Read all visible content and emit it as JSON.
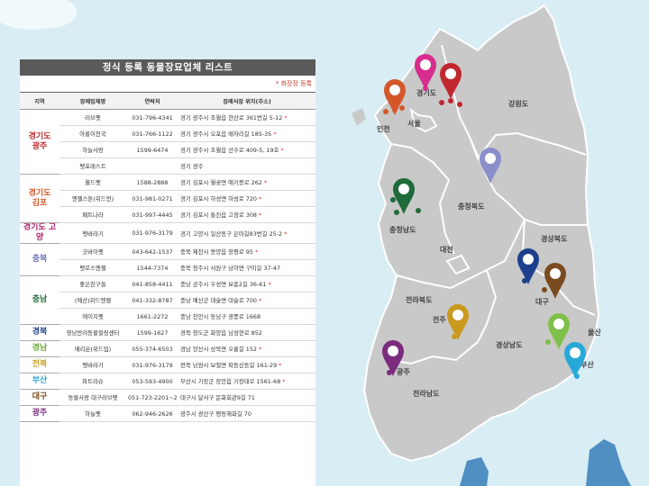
{
  "title": "정식 등록 동물장묘업체 리스트",
  "note": "* 화장장 등록",
  "headers": [
    "지역",
    "장례업체명",
    "연락처",
    "장례식장 위치(주소)"
  ],
  "groups": [
    {
      "region": "경기도\n광주",
      "color": "#c0282e",
      "rows": [
        {
          "name": "러브펫",
          "phone": "031-796-4341",
          "address": "경기 광주시 초월읍 현산로 361번길 5-12",
          "crem": true
        },
        {
          "name": "아롱이천국",
          "phone": "031-766-1122",
          "address": "경기 광주시 오포읍 매자리길 185-35",
          "crem": true
        },
        {
          "name": "하늘사랑",
          "phone": "1599-6474",
          "address": "경기 광주시 초월읍 산수로 409-5, 19호",
          "crem": true
        },
        {
          "name": "펫포레스트",
          "phone": "",
          "address": "경기 광주",
          "crem": false
        }
      ]
    },
    {
      "region": "경기도\n김포",
      "color": "#d4572a",
      "rows": [
        {
          "name": "월드펫",
          "phone": "1588-2888",
          "address": "경기 김포시 월곶면 애기봉로 262",
          "crem": true
        },
        {
          "name": "엔젤스톤(위드언)",
          "phone": "031-981-0271",
          "address": "경기 김포시 하성면 하성로 720",
          "crem": true
        },
        {
          "name": "페트나라",
          "phone": "031-997-4445",
          "address": "경기 김포시 통진읍 고정로 308",
          "crem": true
        }
      ]
    },
    {
      "region": "경기도 고양",
      "color": "#b5226e",
      "rows": [
        {
          "name": "펫바라기",
          "phone": "031-976-3179",
          "address": "경기 고양시 일산동구 은마길83번길 25-2",
          "crem": true
        }
      ]
    },
    {
      "region": "충북",
      "color": "#6a6fb5",
      "rows": [
        {
          "name": "굿바이펫",
          "phone": "043-642-1537",
          "address": "충북 제천시 봉양읍 장평로 95",
          "crem": true
        },
        {
          "name": "펫로스엔젤",
          "phone": "1544-7374",
          "address": "충북 청주시 서원구 남이면 구미길 37-47",
          "crem": false
        }
      ]
    },
    {
      "region": "충남",
      "color": "#1f6b3a",
      "rows": [
        {
          "name": "좋은친구들",
          "phone": "041-858-4411",
          "address": "충남 공주시 우성면 보흥2길 36-61",
          "crem": true
        },
        {
          "name": "(예산)위드엔젤",
          "phone": "041-332-8787",
          "address": "충남 예산군 대술면 대술로 700",
          "crem": true
        },
        {
          "name": "에이지펫",
          "phone": "1661-2272",
          "address": "충남 천안시 동남구 광풍로 1668",
          "crem": false
        }
      ]
    },
    {
      "region": "경북",
      "color": "#1e3f8c",
      "rows": [
        {
          "name": "영남반려동물힐링센터",
          "phone": "1599-1627",
          "address": "경북 청도군 화양읍 남성현로 852",
          "crem": false
        }
      ]
    },
    {
      "region": "경남",
      "color": "#6aa83a",
      "rows": [
        {
          "name": "메리온(위드업)",
          "phone": "055-374-6503",
          "address": "경남 양산시 상북면 오룡길 152",
          "crem": true
        }
      ]
    },
    {
      "region": "전북",
      "color": "#c99a1e",
      "rows": [
        {
          "name": "펫바라기",
          "phone": "031-976-3179",
          "address": "전북 남원시 보절면 파동신동길 161-29",
          "crem": true
        }
      ]
    },
    {
      "region": "부산",
      "color": "#28a8d8",
      "rows": [
        {
          "name": "파트라슈",
          "phone": "053-593-4900",
          "address": "부산시 기장군 장안읍 기장대로 1561-68",
          "crem": true
        }
      ]
    },
    {
      "region": "대구",
      "color": "#7a4b1e",
      "rows": [
        {
          "name": "동물사랑 대구러브펫",
          "phone": "051-723-2201~2",
          "address": "대구시 달서구 문화회관9길 71",
          "crem": false
        }
      ]
    },
    {
      "region": "광주",
      "color": "#7b2c7e",
      "rows": [
        {
          "name": "하늘펫",
          "phone": "062-946-2626",
          "address": "광주시 광산구 평동해화길 70",
          "crem": false
        }
      ]
    }
  ],
  "map_labels": {
    "gangwon": "강원도",
    "gyeonggi": "경기도",
    "seoul": "서울",
    "incheon": "인천",
    "chungbuk": "충청북도",
    "chungnam": "충청남도",
    "daejeon": "대전",
    "gyeongbuk": "경상북도",
    "jeonbuk": "전라북도",
    "jeonju": "전주",
    "daegu": "대구",
    "ulsan": "울산",
    "gyeongnam": "경상남도",
    "busan": "부산",
    "gwangju": "광주",
    "jeonnam": "전라남도"
  },
  "pin_colors": {
    "gimpo": "#d4572a",
    "goyang": "#d62d8f",
    "gwangju_gg": "#c0282e",
    "chungbuk": "#8b8fc9",
    "chungnam": "#1f6b3a",
    "gyeongbuk": "#1e3f8c",
    "daegu": "#7a4b1e",
    "gyeongnam": "#7fc04a",
    "busan": "#28a8d8",
    "jeonbuk": "#c99a1e",
    "gwangju": "#7b2c7e"
  }
}
